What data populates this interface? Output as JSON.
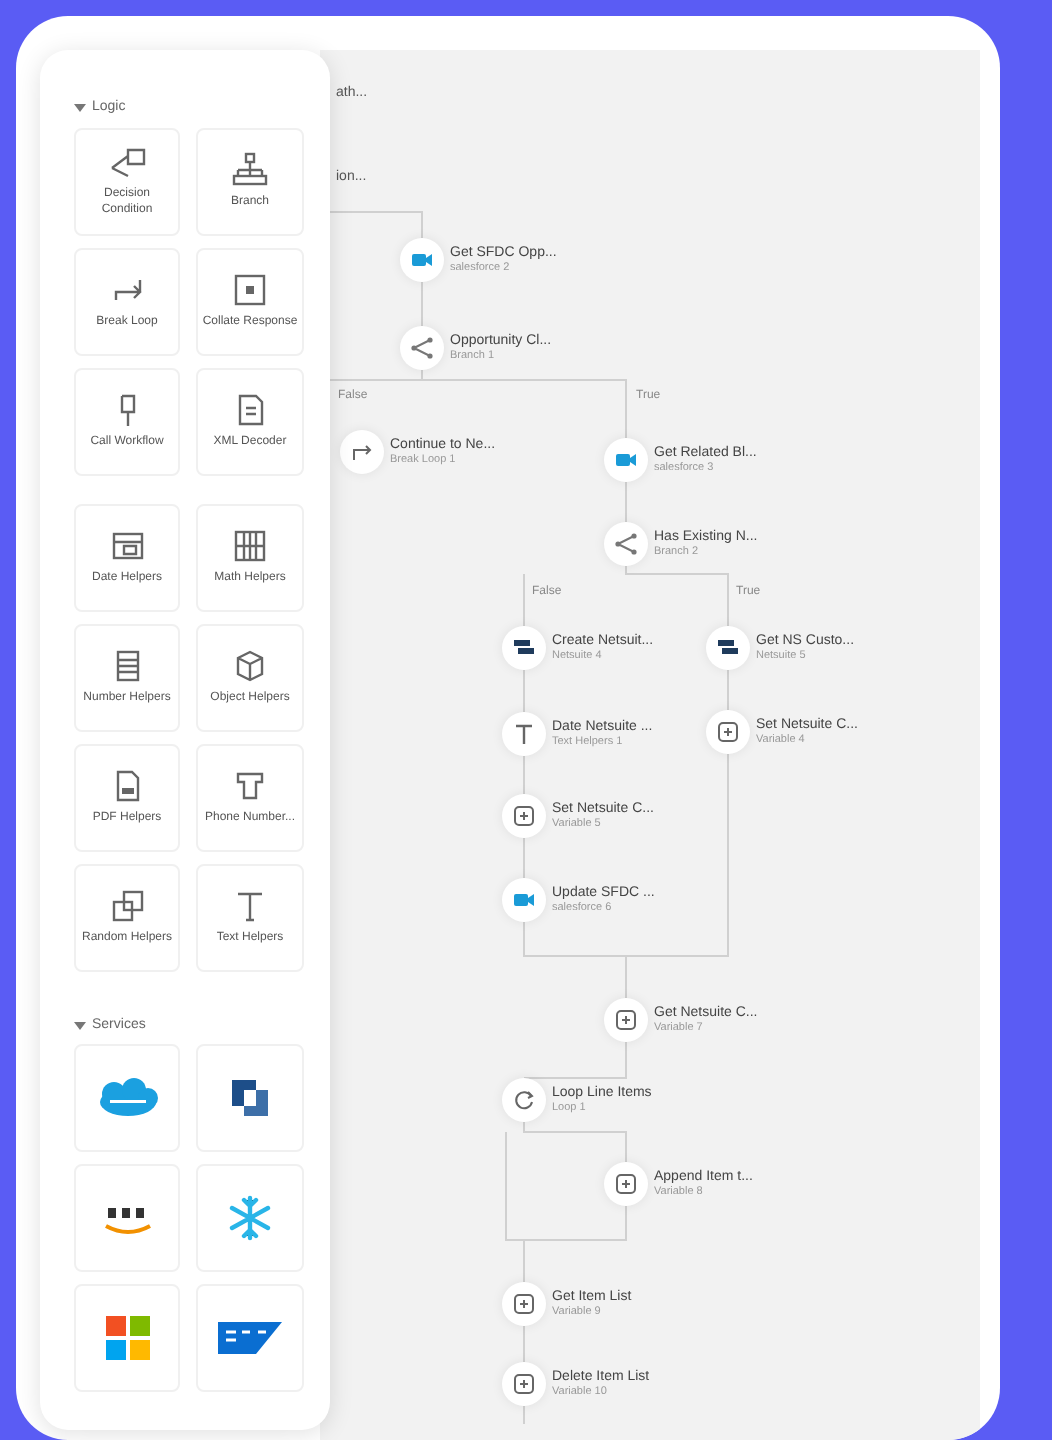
{
  "sidebar": {
    "sections": [
      {
        "title": "Logic",
        "expanded": true,
        "groups": [
          [
            {
              "label": "Decision Condition",
              "kind": "decision"
            },
            {
              "label": "Branch",
              "kind": "branch"
            },
            {
              "label": "Break Loop",
              "kind": "break"
            },
            {
              "label": "Collate Response",
              "kind": "collate"
            },
            {
              "label": "Call Workflow",
              "kind": "flag"
            },
            {
              "label": "XML Decoder",
              "kind": "xml"
            }
          ],
          [
            {
              "label": "Date Helpers",
              "kind": "date"
            },
            {
              "label": "Math Helpers",
              "kind": "math"
            },
            {
              "label": "Number Helpers",
              "kind": "number"
            },
            {
              "label": "Object Helpers",
              "kind": "object"
            },
            {
              "label": "PDF Helpers",
              "kind": "pdf"
            },
            {
              "label": "Phone Number...",
              "kind": "phone"
            },
            {
              "label": "Random Helpers",
              "kind": "random"
            },
            {
              "label": "Text Helpers",
              "kind": "text"
            }
          ]
        ]
      },
      {
        "title": "Services",
        "expanded": true,
        "groups": [
          [
            {
              "kind": "cloud"
            },
            {
              "kind": "nlogo"
            },
            {
              "kind": "smile"
            },
            {
              "kind": "snowflake"
            },
            {
              "kind": "squares"
            },
            {
              "kind": "banner"
            }
          ]
        ]
      }
    ]
  },
  "canvas": {
    "cut_labels": [
      "ath...",
      "ion..."
    ],
    "branch_labels": [
      "False",
      "True",
      "False",
      "True"
    ],
    "nodes": [
      {
        "title": "Get SFDC Opp...",
        "subtitle": "salesforce 2",
        "kind": "salesforce"
      },
      {
        "title": "Opportunity Cl...",
        "subtitle": "Branch 1",
        "kind": "branch"
      },
      {
        "title": "Continue to Ne...",
        "subtitle": "Break Loop 1",
        "kind": "break"
      },
      {
        "title": "Get Related Bl...",
        "subtitle": "salesforce 3",
        "kind": "salesforce"
      },
      {
        "title": "Has Existing N...",
        "subtitle": "Branch 2",
        "kind": "branch"
      },
      {
        "title": "Create Netsuit...",
        "subtitle": "Netsuite 4",
        "kind": "netsuite"
      },
      {
        "title": "Get NS Custo...",
        "subtitle": "Netsuite 5",
        "kind": "netsuite"
      },
      {
        "title": "Date Netsuite ...",
        "subtitle": "Text Helpers 1",
        "kind": "text"
      },
      {
        "title": "Set Netsuite C...",
        "subtitle": "Variable 4",
        "kind": "variable"
      },
      {
        "title": "Set Netsuite C...",
        "subtitle": "Variable 5",
        "kind": "variable"
      },
      {
        "title": "Update SFDC ...",
        "subtitle": "salesforce 6",
        "kind": "salesforce"
      },
      {
        "title": "Get Netsuite C...",
        "subtitle": "Variable 7",
        "kind": "variable"
      },
      {
        "title": "Loop Line Items",
        "subtitle": "Loop 1",
        "kind": "loop"
      },
      {
        "title": "Append Item t...",
        "subtitle": "Variable 8",
        "kind": "variable"
      },
      {
        "title": "Get Item List",
        "subtitle": "Variable 9",
        "kind": "variable"
      },
      {
        "title": "Delete Item List",
        "subtitle": "Variable 10",
        "kind": "variable"
      }
    ]
  }
}
